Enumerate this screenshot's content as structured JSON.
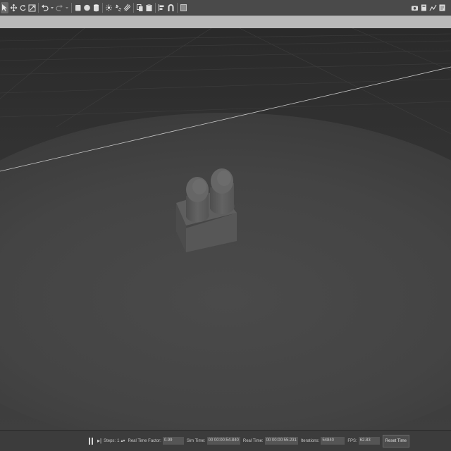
{
  "toolbar": {
    "left_icons": [
      "select-arrow-icon",
      "translate-icon",
      "rotate-icon",
      "scale-icon",
      "undo-icon",
      "undo-dropdown-icon",
      "redo-icon",
      "redo-dropdown-icon",
      "box-shape-icon",
      "sphere-shape-icon",
      "cylinder-shape-icon",
      "point-light-icon",
      "spot-light-icon",
      "directional-light-icon",
      "copy-icon",
      "paste-icon",
      "align-icon",
      "magnet-snap-icon",
      "screenshot-icon"
    ],
    "right_icons": [
      "camera-icon",
      "record-icon",
      "plot-icon",
      "log-icon"
    ]
  },
  "status": {
    "steps_label": "Steps:",
    "steps_value": "1",
    "rtf_label": "Real Time Factor:",
    "rtf_value": "0.99",
    "sim_label": "Sim Time:",
    "sim_value": "00 00:00:54.840",
    "real_label": "Real Time:",
    "real_value": "00 00:00:55.231",
    "iter_label": "Iterations:",
    "iter_value": "54840",
    "fps_label": "FPS:",
    "fps_value": "62.83",
    "reset_label": "Reset Time"
  }
}
